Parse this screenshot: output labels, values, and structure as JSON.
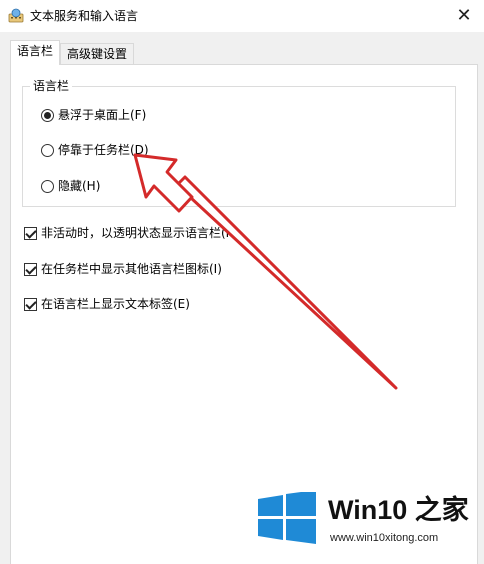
{
  "window": {
    "title": "文本服务和输入语言",
    "close_glyph": "✕"
  },
  "tabs": [
    {
      "label": "语言栏",
      "active": true
    },
    {
      "label": "高级键设置",
      "active": false
    }
  ],
  "language_bar_group": {
    "title": "语言栏",
    "options": [
      {
        "label": "悬浮于桌面上(F)",
        "checked": true
      },
      {
        "label": "停靠于任务栏(D)",
        "checked": false
      },
      {
        "label": "隐藏(H)",
        "checked": false
      }
    ]
  },
  "checkboxes": [
    {
      "label": "非活动时，以透明状态显示语言栏(N)",
      "checked": true
    },
    {
      "label": "在任务栏中显示其他语言栏图标(I)",
      "checked": true
    },
    {
      "label": "在语言栏上显示文本标签(E)",
      "checked": true
    }
  ],
  "annotation": {
    "arrow_color": "#d42a2a"
  },
  "watermark": {
    "brand_prefix": "Win10",
    "brand_suffix": "之家",
    "url": "www.win10xitong.com",
    "logo_color": "#1f8ad6"
  }
}
